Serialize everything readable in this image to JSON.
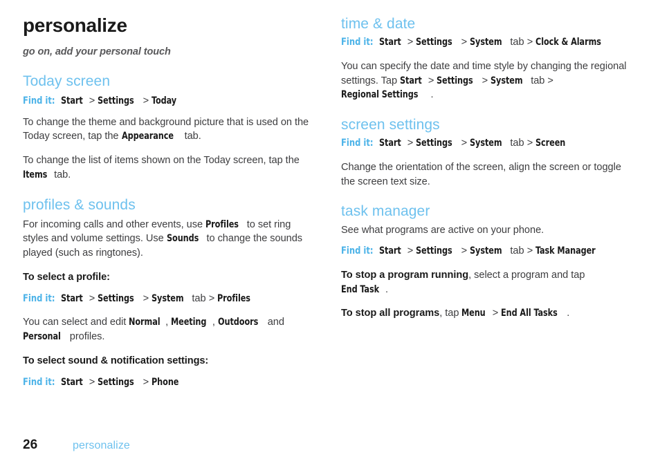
{
  "document": {
    "chapter_title": "personalize",
    "chapter_subtitle": "go on, add your personal touch"
  },
  "labels": {
    "find_it": "Find it:",
    "gt": ">",
    "tab": "tab",
    "comma": ",",
    "period": ".",
    "and": "and"
  },
  "left_column": {
    "today_screen": {
      "heading": "Today screen",
      "find_it_path": {
        "start": "Start",
        "settings": "Settings",
        "today": "Today"
      },
      "para1_a": "To change the theme and background picture that is used on the Today screen, tap the ",
      "para1_term": "Appearance",
      "para1_b": " tab.",
      "para2_a": "To change the list of items shown on the Today screen, tap the ",
      "para2_term": "Items",
      "para2_b": " tab."
    },
    "profiles_sounds": {
      "heading": "profiles & sounds",
      "para1_a": "For incoming calls and other events, use ",
      "para1_term1": "Profiles",
      "para1_b": " to set ring styles and volume settings. Use ",
      "para1_term2": "Sounds",
      "para1_c": " to change the sounds played (such as ringtones).",
      "subhead_profile": "To select a profile:",
      "find_it_path": {
        "start": "Start",
        "settings": "Settings",
        "system": "System",
        "profiles": "Profiles"
      },
      "para2_a": "You can select and edit ",
      "profile_normal": "Normal",
      "profile_meeting": "Meeting",
      "profile_outdoors": "Outdoors",
      "profile_personal": "Personal",
      "para2_b": " profiles.",
      "subhead_sound": "To select sound & notification settings:",
      "find_it_path2": {
        "start": "Start",
        "settings": "Settings",
        "phone": "Phone"
      }
    }
  },
  "right_column": {
    "time_date": {
      "heading": "time & date",
      "find_it_path": {
        "start": "Start",
        "settings": "Settings",
        "system": "System",
        "clock_alarms": "Clock & Alarms"
      },
      "para1_a": "You can specify the date and time style by changing the regional settings. Tap ",
      "term_start": "Start",
      "term_settings": "Settings",
      "term_system": "System",
      "term_regional": "Regional Settings",
      "para1_end": "."
    },
    "screen_settings": {
      "heading": "screen settings",
      "find_it_path": {
        "start": "Start",
        "settings": "Settings",
        "system": "System",
        "screen": "Screen"
      },
      "para1": "Change the orientation of the screen, align the screen or toggle the screen text size."
    },
    "task_manager": {
      "heading": "task manager",
      "para1": "See what programs are active on your phone.",
      "find_it_path": {
        "start": "Start",
        "settings": "Settings",
        "system": "System",
        "task_manager": "Task Manager"
      },
      "stop_program_lead": "To stop a program running",
      "stop_program_a": ", select a program and tap ",
      "stop_program_term": "End Task",
      "stop_program_b": ".",
      "stop_all_lead": "To stop all programs",
      "stop_all_a": ", tap ",
      "stop_all_term1": "Menu",
      "stop_all_term2": "End All Tasks",
      "stop_all_b": "."
    }
  },
  "footer": {
    "page_number": "26",
    "chapter": "personalize"
  }
}
